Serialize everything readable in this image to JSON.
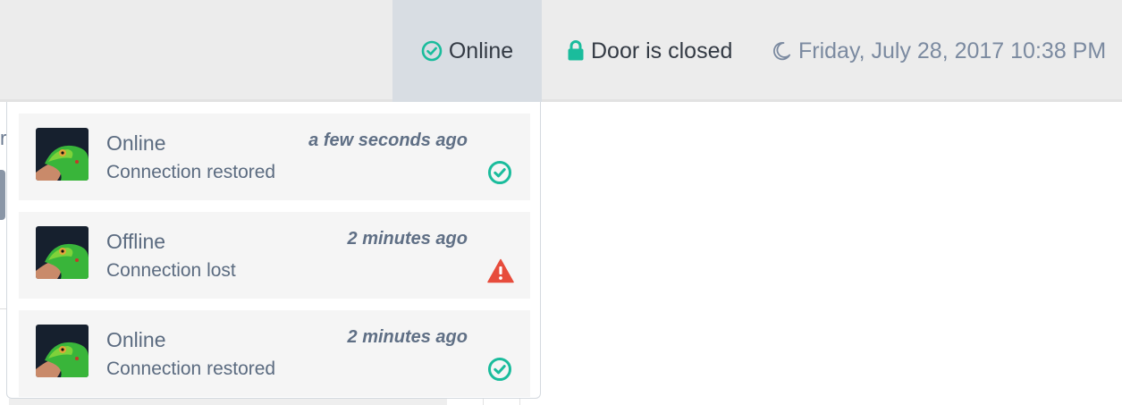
{
  "header": {
    "status": {
      "label": "Online",
      "icon": "check-circle-icon"
    },
    "door": {
      "label": "Door is closed",
      "icon": "lock-icon"
    },
    "clock": {
      "label": "Friday, July 28, 2017 10:38 PM",
      "icon": "moon-icon"
    }
  },
  "colors": {
    "success": "#1abc9c",
    "danger": "#e74c3c",
    "text": "#5b6b80",
    "header_bg": "#ececec",
    "active_tab_bg": "#d8dde3"
  },
  "notifications": [
    {
      "title": "Online",
      "message": "Connection restored",
      "time": "a few seconds ago",
      "status_icon": "check-circle-icon"
    },
    {
      "title": "Offline",
      "message": "Connection lost",
      "time": "2 minutes ago",
      "status_icon": "warning-icon"
    },
    {
      "title": "Online",
      "message": "Connection restored",
      "time": "2 minutes ago",
      "status_icon": "check-circle-icon"
    }
  ]
}
